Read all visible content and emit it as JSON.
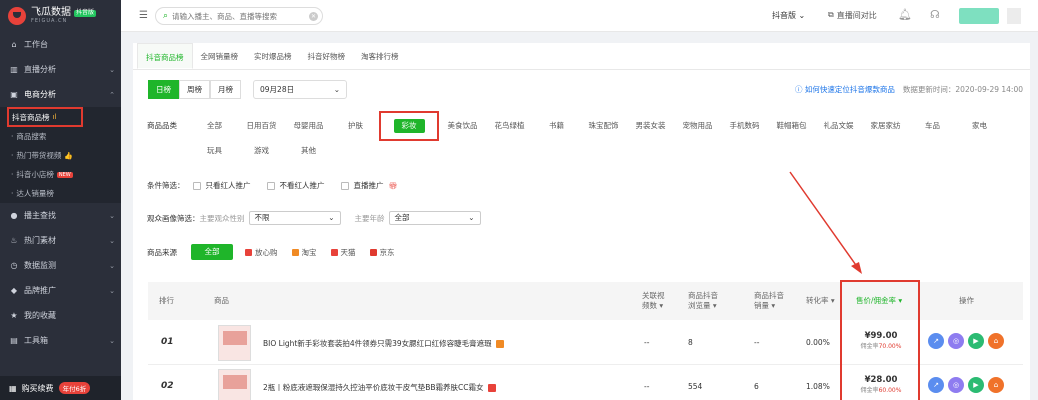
{
  "sidebar": {
    "brand": "飞瓜数据",
    "brand_tag": "抖音版",
    "brand_sub": "FEIGUA.CN",
    "items": [
      {
        "label": "工作台",
        "icon": "home-icon",
        "glyph": "⌂"
      },
      {
        "label": "直播分析",
        "icon": "bar-chart-icon",
        "glyph": "▥",
        "chev": "⌄"
      },
      {
        "label": "电商分析",
        "icon": "shop-icon",
        "glyph": "▣",
        "chev": "⌃"
      }
    ],
    "sub_items": [
      {
        "label": "抖音商品榜"
      },
      {
        "label": "商品搜索"
      },
      {
        "label": "热门带货视频"
      },
      {
        "label": "抖音小店榜",
        "badge": "NEW"
      },
      {
        "label": "达人销量榜"
      }
    ],
    "items2": [
      {
        "label": "播主查找",
        "icon": "user-search-icon",
        "glyph": "●",
        "chev": "⌄"
      },
      {
        "label": "热门素材",
        "icon": "fire-icon",
        "glyph": "♨",
        "chev": "⌄"
      },
      {
        "label": "数据监测",
        "icon": "monitor-icon",
        "glyph": "◷",
        "chev": "⌄"
      },
      {
        "label": "品牌推广",
        "icon": "diamond-icon",
        "glyph": "◆",
        "chev": "⌄"
      },
      {
        "label": "我的收藏",
        "icon": "star-icon",
        "glyph": "★"
      },
      {
        "label": "工具箱",
        "icon": "toolbox-icon",
        "glyph": "▤",
        "chev": "⌄"
      }
    ],
    "renew_label": "购买续费",
    "renew_tag": "年付6折"
  },
  "header": {
    "search_placeholder": "请输入播主、商品、直播等搜索",
    "platform": "抖音版 ⌄",
    "live_compare": "直播间对比"
  },
  "tabs": [
    "抖音商品榜",
    "全网销量榜",
    "实时爆品榜",
    "抖音好物榜",
    "淘客排行榜"
  ],
  "period": {
    "options": [
      "日榜",
      "周榜",
      "月榜"
    ],
    "date": "09月28日"
  },
  "help_link": "如何快速定位抖音爆款商品",
  "update_time": "数据更新时间：2020-09-29 14:00",
  "category_label": "商品品类",
  "categories": [
    "全部",
    "日用百货",
    "母婴用品",
    "护肤",
    "彩妆",
    "美食饮品",
    "花鸟绿植",
    "书籍",
    "珠宝配饰",
    "男装女装",
    "宠物用品",
    "手机数码",
    "鞋帽箱包",
    "礼品文娱",
    "家居家纺",
    "车品",
    "家电",
    "玩具",
    "游戏",
    "其他"
  ],
  "filters": {
    "condition_label": "条件筛选：",
    "options": [
      "只看红人推广",
      "不看红人推广",
      "直播推广"
    ],
    "audience_label": "观众画像筛选：",
    "gender_label": "主要观众性别",
    "gender_value": "不限",
    "age_label": "主要年龄",
    "age_value": "全部",
    "source_label": "商品来源",
    "source_all": "全部",
    "sources": [
      {
        "label": "放心购",
        "color": "#e8423a"
      },
      {
        "label": "淘宝",
        "color": "#f08a24"
      },
      {
        "label": "天猫",
        "color": "#e8423a"
      },
      {
        "label": "京东",
        "color": "#e03a2f"
      }
    ]
  },
  "table": {
    "headers": {
      "rank": "排行",
      "product": "商品",
      "videos": "关联视\n频数",
      "views": "商品抖音\n浏览量",
      "sales": "商品抖音\n销量",
      "conversion": "转化率",
      "price": "售价/佣金率",
      "ops": "操作"
    },
    "rows": [
      {
        "rank": "01",
        "name": "BIO Light新手彩妆套装拍4件领券只需39女腮红口红修容睫毛膏遮瑕",
        "videos": "--",
        "views": "8",
        "sales": "--",
        "conversion": "0.00%",
        "price": "¥99.00",
        "commission_label": "佣金率",
        "commission": "70.00%"
      },
      {
        "rank": "02",
        "name": "2瓶丨粉底液遮瑕保湿持久控油平价底妆干皮气垫BB霜养肤CC霜女",
        "videos": "--",
        "views": "554",
        "sales": "6",
        "conversion": "1.08%",
        "price": "¥28.00",
        "commission_label": "佣金率",
        "commission": "60.00%"
      }
    ]
  },
  "colors": {
    "accent": "#1fb52a",
    "highlight": "#e03a2f",
    "sidebar": "#2b2f3a"
  }
}
